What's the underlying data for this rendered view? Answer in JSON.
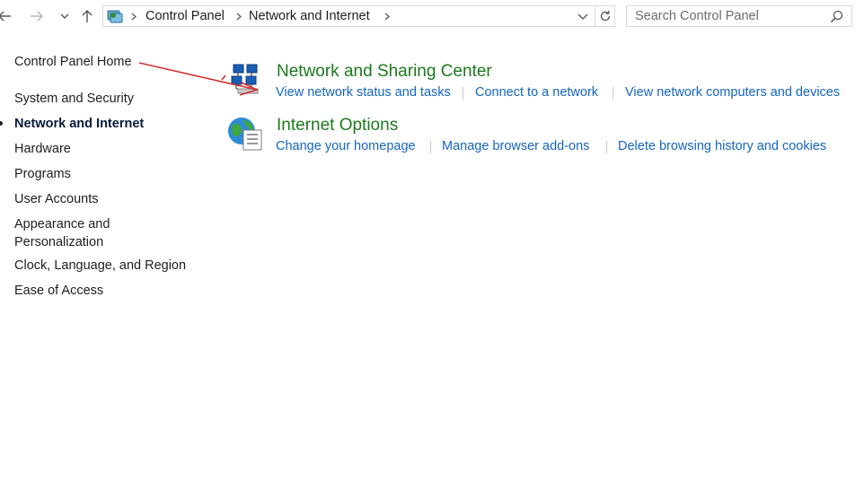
{
  "breadcrumb": {
    "items": [
      "Control Panel",
      "Network and Internet"
    ]
  },
  "search": {
    "placeholder": "Search Control Panel"
  },
  "sidebar": {
    "home": "Control Panel Home",
    "items": [
      {
        "label": "System and Security"
      },
      {
        "label": "Network and Internet",
        "active": true
      },
      {
        "label": "Hardware"
      },
      {
        "label": "Programs"
      },
      {
        "label": "User Accounts"
      },
      {
        "label": "Appearance and"
      },
      {
        "label": "Personalization"
      },
      {
        "label": "Clock, Language, and Region"
      },
      {
        "label": "Ease of Access"
      }
    ]
  },
  "categories": [
    {
      "title": "Network and Sharing Center",
      "icon": "network-sharing-icon",
      "links": [
        "View network status and tasks",
        "Connect to a network",
        "View network computers and devices"
      ]
    },
    {
      "title": "Internet Options",
      "icon": "internet-options-icon",
      "links": [
        "Change your homepage",
        "Manage browser add-ons",
        "Delete browsing history and cookies"
      ]
    }
  ],
  "colors": {
    "category_title": "#1d7a1d",
    "link": "#1565c0",
    "annotation_arrow": "#d32f2f"
  }
}
